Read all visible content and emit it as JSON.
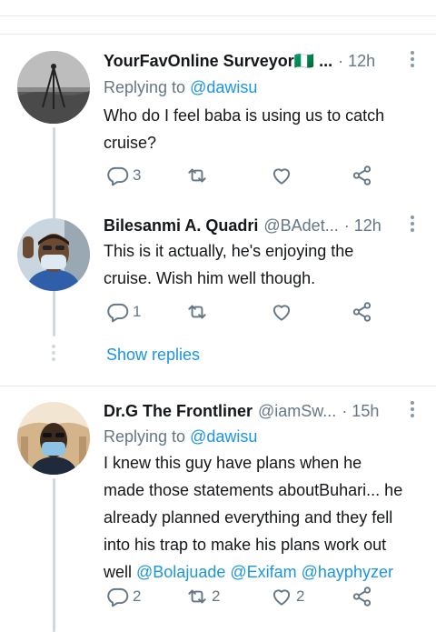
{
  "tweets": [
    {
      "name": "YourFavOnline Surveyor🇳🇬 ...",
      "handle": "",
      "time": "· 12h",
      "replying_prefix": "Replying to ",
      "replying_to": "@dawisu",
      "text_lines": [
        "Who do I feel baba is using us to catch",
        "cruise?"
      ],
      "counts": {
        "reply": "3",
        "retweet": "",
        "like": ""
      }
    },
    {
      "name": "Bilesanmi A. Quadri",
      "handle": "@BAdet...",
      "time": "· 12h",
      "text_lines": [
        "This is it actually, he's enjoying the",
        "cruise. Wish him well though."
      ],
      "counts": {
        "reply": "1",
        "retweet": "",
        "like": ""
      }
    },
    {
      "name": "Dr.G The Frontliner",
      "handle": "@iamSw...",
      "time": "· 15h",
      "replying_prefix": "Replying to ",
      "replying_to": "@dawisu",
      "text_lines": [
        "I knew this guy have plans when he",
        "made those statements aboutBuhari... he",
        "already planned everything and they fell",
        "into his trap to make his plans work out"
      ],
      "last_line_prefix": "well ",
      "last_line_mentions": "@Bolajuade @Exifam @hayphyzer",
      "counts": {
        "reply": "2",
        "retweet": "2",
        "like": "2"
      }
    }
  ],
  "show_replies_label": "Show replies",
  "colors": {
    "link": "#1b95e0",
    "muted": "#657786",
    "divider": "#e1e8ed"
  }
}
